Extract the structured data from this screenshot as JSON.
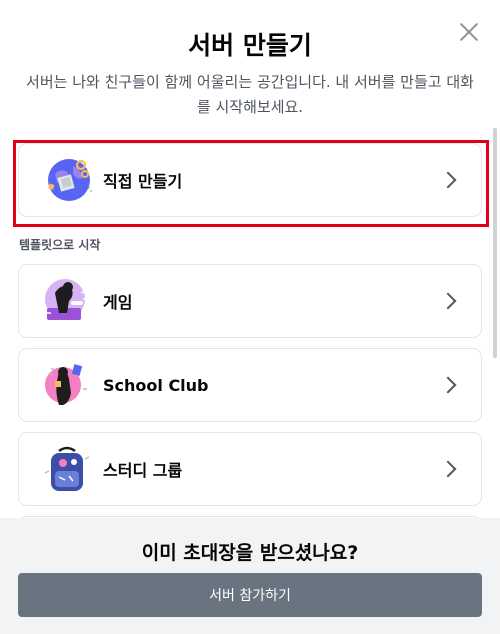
{
  "header": {
    "title": "서버 만들기",
    "subtitle": "서버는 나와 친구들이 함께 어울리는 공간입니다. 내 서버를 만들고 대화를 시작해보세요."
  },
  "create_option": {
    "label": "직접 만들기",
    "icon": "globe-create-icon"
  },
  "templates": {
    "section_label": "템플릿으로 시작",
    "items": [
      {
        "label": "게임",
        "icon": "gaming-icon"
      },
      {
        "label": "School Club",
        "icon": "school-club-icon"
      },
      {
        "label": "스터디 그룹",
        "icon": "study-group-backpack-icon"
      }
    ]
  },
  "footer": {
    "question": "이미 초대장을 받으셨나요?",
    "join_button": "서버 참가하기"
  },
  "colors": {
    "highlight": "#e00018",
    "join_button_bg": "#6a7480",
    "footer_bg": "#f2f3f5"
  }
}
